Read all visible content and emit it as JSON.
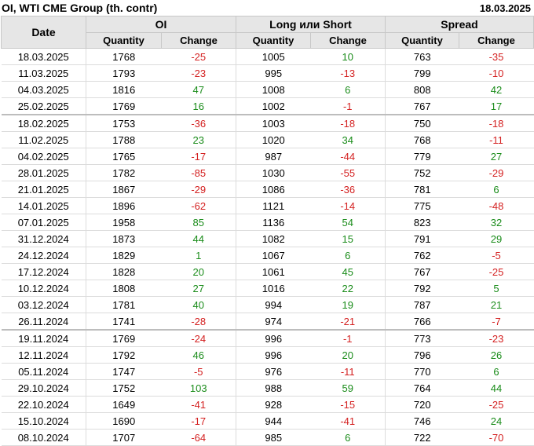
{
  "header": {
    "title": "OI, WTI CME Group (th. contr)",
    "date": "18.03.2025"
  },
  "columns": {
    "date": "Date",
    "groups": [
      "OI",
      "Long или Short",
      "Spread"
    ],
    "quantity": "Quantity",
    "change": "Change"
  },
  "colors": {
    "positive": "#1a8c1a",
    "negative": "#d42121"
  },
  "rows": [
    [
      "18.03.2025",
      "1768",
      "-25",
      "1005",
      "10",
      "763",
      "-35"
    ],
    [
      "11.03.2025",
      "1793",
      "-23",
      "995",
      "-13",
      "799",
      "-10"
    ],
    [
      "04.03.2025",
      "1816",
      "47",
      "1008",
      "6",
      "808",
      "42"
    ],
    [
      "25.02.2025",
      "1769",
      "16",
      "1002",
      "-1",
      "767",
      "17"
    ],
    [
      "18.02.2025",
      "1753",
      "-36",
      "1003",
      "-18",
      "750",
      "-18"
    ],
    [
      "11.02.2025",
      "1788",
      "23",
      "1020",
      "34",
      "768",
      "-11"
    ],
    [
      "04.02.2025",
      "1765",
      "-17",
      "987",
      "-44",
      "779",
      "27"
    ],
    [
      "28.01.2025",
      "1782",
      "-85",
      "1030",
      "-55",
      "752",
      "-29"
    ],
    [
      "21.01.2025",
      "1867",
      "-29",
      "1086",
      "-36",
      "781",
      "6"
    ],
    [
      "14.01.2025",
      "1896",
      "-62",
      "1121",
      "-14",
      "775",
      "-48"
    ],
    [
      "07.01.2025",
      "1958",
      "85",
      "1136",
      "54",
      "823",
      "32"
    ],
    [
      "31.12.2024",
      "1873",
      "44",
      "1082",
      "15",
      "791",
      "29"
    ],
    [
      "24.12.2024",
      "1829",
      "1",
      "1067",
      "6",
      "762",
      "-5"
    ],
    [
      "17.12.2024",
      "1828",
      "20",
      "1061",
      "45",
      "767",
      "-25"
    ],
    [
      "10.12.2024",
      "1808",
      "27",
      "1016",
      "22",
      "792",
      "5"
    ],
    [
      "03.12.2024",
      "1781",
      "40",
      "994",
      "19",
      "787",
      "21"
    ],
    [
      "26.11.2024",
      "1741",
      "-28",
      "974",
      "-21",
      "766",
      "-7"
    ],
    [
      "19.11.2024",
      "1769",
      "-24",
      "996",
      "-1",
      "773",
      "-23"
    ],
    [
      "12.11.2024",
      "1792",
      "46",
      "996",
      "20",
      "796",
      "26"
    ],
    [
      "05.11.2024",
      "1747",
      "-5",
      "976",
      "-11",
      "770",
      "6"
    ],
    [
      "29.10.2024",
      "1752",
      "103",
      "988",
      "59",
      "764",
      "44"
    ],
    [
      "22.10.2024",
      "1649",
      "-41",
      "928",
      "-15",
      "720",
      "-25"
    ],
    [
      "15.10.2024",
      "1690",
      "-17",
      "944",
      "-41",
      "746",
      "24"
    ],
    [
      "08.10.2024",
      "1707",
      "-64",
      "985",
      "6",
      "722",
      "-70"
    ]
  ],
  "separator_after_rows": [
    3,
    16
  ]
}
